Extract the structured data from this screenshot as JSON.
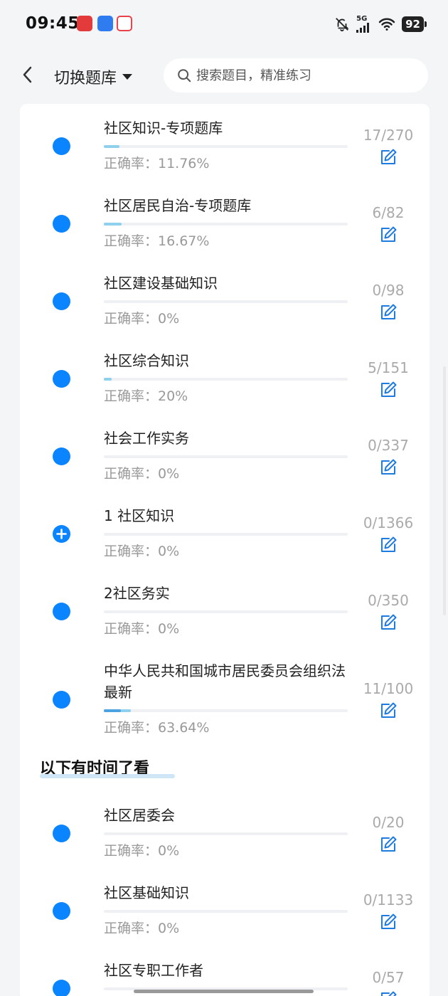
{
  "status_bar": {
    "time": "09:45",
    "network": "5G",
    "battery": "92"
  },
  "header": {
    "back_icon": "chevron-left-icon",
    "switch_label": "切换题库",
    "search_placeholder": "搜索题目，精准练习"
  },
  "items": [
    {
      "title": "社区知识-专项题库",
      "count": "17/270",
      "accuracy": "正确率：11.76%",
      "icon": "dot",
      "progress": 0.063,
      "correct_progress": 0.0
    },
    {
      "title": "社区居民自治-专项题库",
      "count": "6/82",
      "accuracy": "正确率：16.67%",
      "icon": "dot",
      "progress": 0.073,
      "correct_progress": 0.0
    },
    {
      "title": "社区建设基础知识",
      "count": "0/98",
      "accuracy": "正确率：0%",
      "icon": "dot",
      "progress": 0.0,
      "correct_progress": 0.0
    },
    {
      "title": "社区综合知识",
      "count": "5/151",
      "accuracy": "正确率：20%",
      "icon": "dot",
      "progress": 0.033,
      "correct_progress": 0.0
    },
    {
      "title": "社会工作实务",
      "count": "0/337",
      "accuracy": "正确率：0%",
      "icon": "dot",
      "progress": 0.0,
      "correct_progress": 0.0
    },
    {
      "title": "1 社区知识",
      "count": "0/1366",
      "accuracy": "正确率：0%",
      "icon": "plus",
      "progress": 0.0,
      "correct_progress": 0.0
    },
    {
      "title": "2社区务实",
      "count": "0/350",
      "accuracy": "正确率：0%",
      "icon": "dot",
      "progress": 0.0,
      "correct_progress": 0.0
    },
    {
      "title": "中华人民共和国城市居民委员会组织法 最新",
      "count": "11/100",
      "accuracy": "正确率：63.64%",
      "icon": "dot",
      "progress": 0.11,
      "correct_progress": 0.07
    }
  ],
  "section_title": "以下有时间了看",
  "items_later": [
    {
      "title": "社区居委会",
      "count": "0/20",
      "accuracy": "正确率：0%",
      "icon": "dot",
      "progress": 0.0,
      "correct_progress": 0.0
    },
    {
      "title": "社区基础知识",
      "count": "0/1133",
      "accuracy": "正确率：0%",
      "icon": "dot",
      "progress": 0.0,
      "correct_progress": 0.0
    },
    {
      "title": "社区专职工作者",
      "count": "0/57",
      "accuracy": "",
      "icon": "dot",
      "progress": 0.0,
      "correct_progress": 0.0
    }
  ],
  "colors": {
    "accent": "#0a84ff",
    "progress": "#8fd0ec",
    "progress_correct": "#4aa3e0",
    "muted": "#999999"
  }
}
